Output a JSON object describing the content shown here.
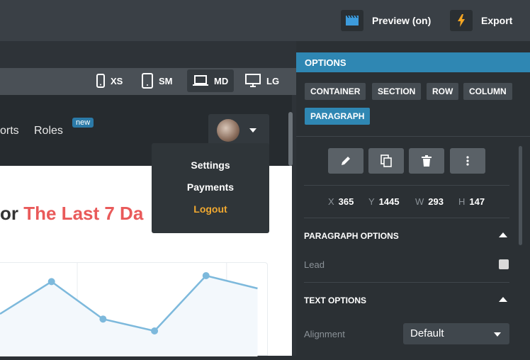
{
  "topbar": {
    "preview_label": "Preview (on)",
    "export_label": "Export"
  },
  "devices": [
    {
      "label": "XS",
      "icon": "phone-icon"
    },
    {
      "label": "SM",
      "icon": "tablet-icon"
    },
    {
      "label": "MD",
      "icon": "laptop-icon",
      "active": true
    },
    {
      "label": "LG",
      "icon": "desktop-icon"
    }
  ],
  "nav": {
    "link_reports": "orts",
    "link_roles": "Roles",
    "badge": "new"
  },
  "user_menu": {
    "settings": "Settings",
    "payments": "Payments",
    "logout": "Logout"
  },
  "page": {
    "heading_prefix": "or",
    "heading_highlight": "The Last 7 Da"
  },
  "chart_data": {
    "type": "line",
    "points": [
      [
        0,
        50
      ],
      [
        1,
        88
      ],
      [
        2,
        44
      ],
      [
        3,
        30
      ],
      [
        4,
        95
      ],
      [
        5,
        80
      ]
    ],
    "xlim": [
      0,
      5.2
    ],
    "ylim": [
      0,
      110
    ]
  },
  "options": {
    "title": "OPTIONS",
    "chips": [
      "CONTAINER",
      "SECTION",
      "ROW",
      "COLUMN",
      "PARAGRAPH"
    ],
    "active_chip": "PARAGRAPH",
    "coords": {
      "x": "365",
      "y": "1445",
      "w": "293",
      "h": "147"
    },
    "coord_labels": {
      "x": "X",
      "y": "Y",
      "w": "W",
      "h": "H"
    },
    "paragraph_options_title": "PARAGRAPH OPTIONS",
    "lead_label": "Lead",
    "lead_checked": false,
    "text_options_title": "TEXT OPTIONS",
    "alignment_label": "Alignment",
    "alignment_value": "Default"
  },
  "colors": {
    "accent": "#2f87b3",
    "logout": "#f0a830",
    "heading_red": "#e95a5a",
    "line": "#7db9dc"
  }
}
